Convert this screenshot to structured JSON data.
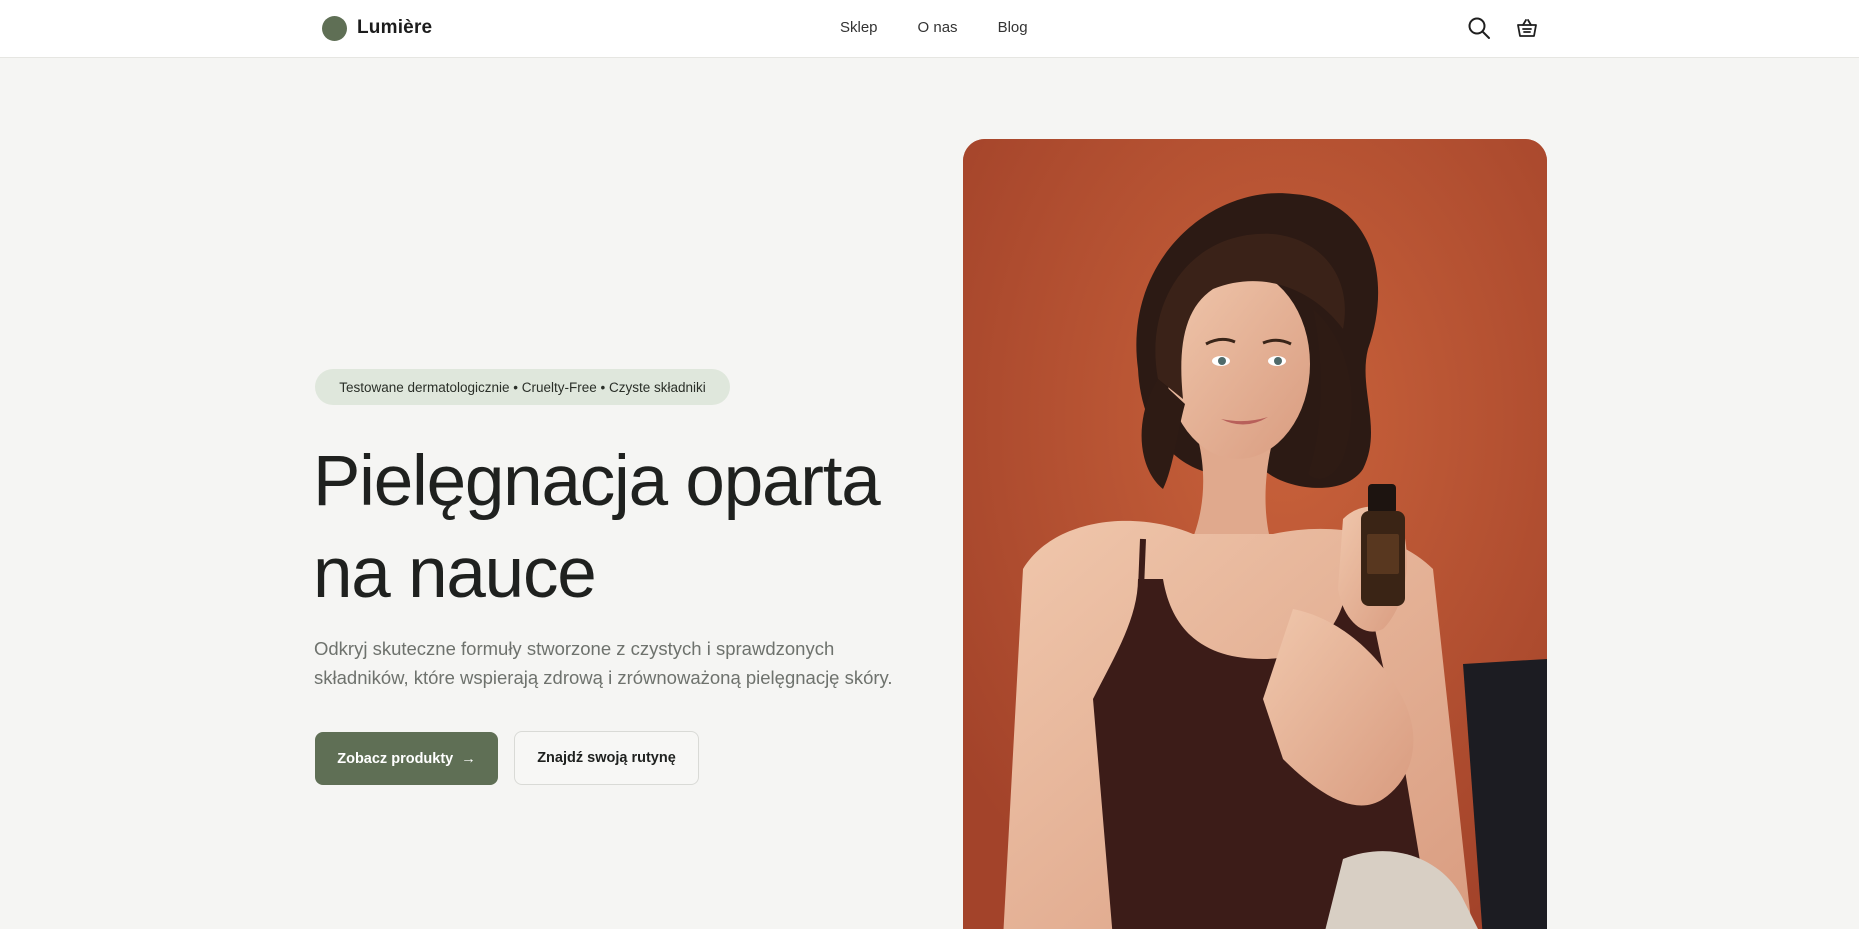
{
  "header": {
    "brand": "Lumière",
    "nav": [
      {
        "label": "Sklep"
      },
      {
        "label": "O nas"
      },
      {
        "label": "Blog"
      }
    ],
    "icons": [
      "search-icon",
      "basket-icon"
    ]
  },
  "hero": {
    "badge": "Testowane dermatologicznie • Cruelty-Free • Czyste składniki",
    "headline": "Pielęgnacja oparta na nauce",
    "subtext": "Odkryj skuteczne formuły stworzone z czystych i sprawdzonych składników, które wspierają zdrową i zrównoważoną pielęgnację skóry.",
    "primary_button": "Zobacz produkty",
    "primary_arrow": "→",
    "secondary_button": "Znajdź swoją rutynę"
  },
  "colors": {
    "accent": "#5f6f55",
    "badge_bg": "#dfe7dc",
    "background": "#f5f5f3",
    "image_bg": "#b04a2c"
  }
}
